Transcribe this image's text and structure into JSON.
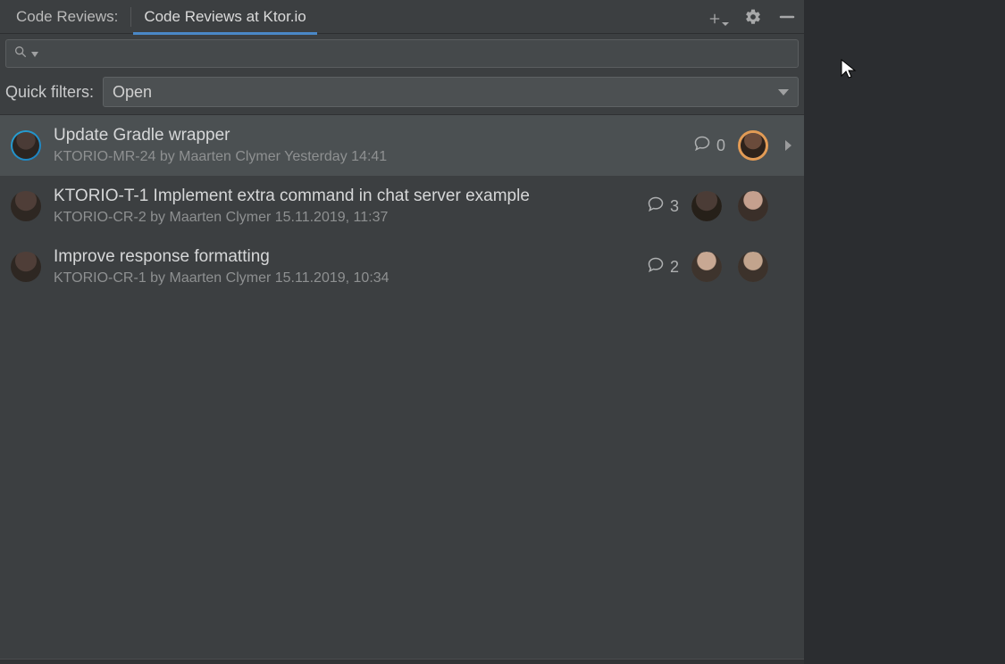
{
  "header": {
    "tool_window_label": "Code Reviews:",
    "active_tab": "Code Reviews at Ktor.io"
  },
  "search": {
    "value": "",
    "placeholder": ""
  },
  "filters": {
    "label": "Quick filters:",
    "selected": "Open"
  },
  "reviews": [
    {
      "title": "Update Gradle wrapper",
      "subtitle": "KTORIO-MR-24 by Maarten Clymer Yesterday 14:41",
      "comments": "0",
      "selected": true,
      "reviewer_ring": true,
      "reviewer_count": 1,
      "show_chevron": true
    },
    {
      "title": "KTORIO-T-1 Implement extra command in chat server example",
      "subtitle": "KTORIO-CR-2 by Maarten Clymer 15.11.2019, 11:37",
      "comments": "3",
      "selected": false,
      "reviewer_ring": false,
      "reviewer_count": 2,
      "show_chevron": false
    },
    {
      "title": "Improve response formatting",
      "subtitle": "KTORIO-CR-1 by Maarten Clymer 15.11.2019, 10:34",
      "comments": "2",
      "selected": false,
      "reviewer_ring": false,
      "reviewer_count": 2,
      "show_chevron": false
    }
  ]
}
